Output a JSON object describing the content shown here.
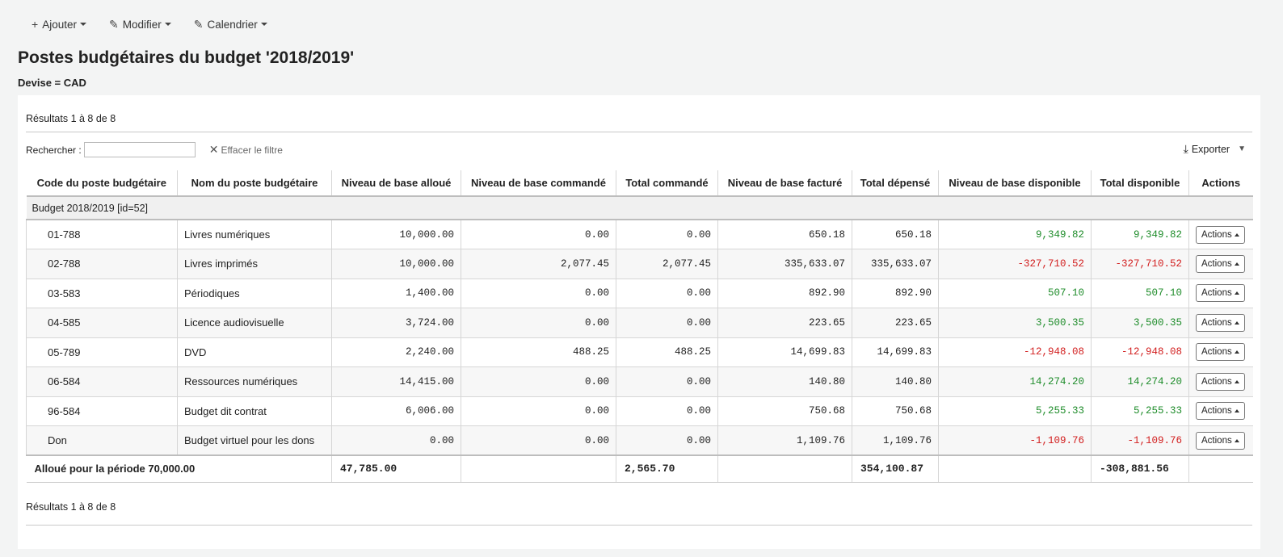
{
  "toolbar": {
    "add": "Ajouter",
    "edit": "Modifier",
    "calendar": "Calendrier"
  },
  "page": {
    "title": "Postes budgétaires du budget '2018/2019'",
    "currency_label": "Devise =",
    "currency_value": "CAD"
  },
  "results_info": "Résultats 1 à 8 de 8",
  "search": {
    "label": "Rechercher :",
    "value": "",
    "clear_label": "Effacer le filtre"
  },
  "export_label": "Exporter",
  "table": {
    "headers": [
      "Code du poste budgétaire",
      "Nom du poste budgétaire",
      "Niveau de base alloué",
      "Niveau de base commandé",
      "Total commandé",
      "Niveau de base facturé",
      "Total dépensé",
      "Niveau de base disponible",
      "Total disponible",
      "Actions"
    ],
    "group_label": "Budget 2018/2019 [id=52]",
    "rows": [
      {
        "code": "01-788",
        "name": "Livres numériques",
        "alloue": "10,000.00",
        "base_commande": "0.00",
        "total_commande": "0.00",
        "base_facture": "650.18",
        "total_depense": "650.18",
        "base_dispo": "9,349.82",
        "total_dispo": "9,349.82",
        "status": "pos"
      },
      {
        "code": "02-788",
        "name": "Livres imprimés",
        "alloue": "10,000.00",
        "base_commande": "2,077.45",
        "total_commande": "2,077.45",
        "base_facture": "335,633.07",
        "total_depense": "335,633.07",
        "base_dispo": "-327,710.52",
        "total_dispo": "-327,710.52",
        "status": "neg"
      },
      {
        "code": "03-583",
        "name": "Périodiques",
        "alloue": "1,400.00",
        "base_commande": "0.00",
        "total_commande": "0.00",
        "base_facture": "892.90",
        "total_depense": "892.90",
        "base_dispo": "507.10",
        "total_dispo": "507.10",
        "status": "pos"
      },
      {
        "code": "04-585",
        "name": "Licence audiovisuelle",
        "alloue": "3,724.00",
        "base_commande": "0.00",
        "total_commande": "0.00",
        "base_facture": "223.65",
        "total_depense": "223.65",
        "base_dispo": "3,500.35",
        "total_dispo": "3,500.35",
        "status": "pos"
      },
      {
        "code": "05-789",
        "name": "DVD",
        "alloue": "2,240.00",
        "base_commande": "488.25",
        "total_commande": "488.25",
        "base_facture": "14,699.83",
        "total_depense": "14,699.83",
        "base_dispo": "-12,948.08",
        "total_dispo": "-12,948.08",
        "status": "neg"
      },
      {
        "code": "06-584",
        "name": "Ressources numériques",
        "alloue": "14,415.00",
        "base_commande": "0.00",
        "total_commande": "0.00",
        "base_facture": "140.80",
        "total_depense": "140.80",
        "base_dispo": "14,274.20",
        "total_dispo": "14,274.20",
        "status": "pos"
      },
      {
        "code": "96-584",
        "name": "Budget dit contrat",
        "alloue": "6,006.00",
        "base_commande": "0.00",
        "total_commande": "0.00",
        "base_facture": "750.68",
        "total_depense": "750.68",
        "base_dispo": "5,255.33",
        "total_dispo": "5,255.33",
        "status": "pos"
      },
      {
        "code": "Don",
        "name": "Budget virtuel pour les dons",
        "alloue": "0.00",
        "base_commande": "0.00",
        "total_commande": "0.00",
        "base_facture": "1,109.76",
        "total_depense": "1,109.76",
        "base_dispo": "-1,109.76",
        "total_dispo": "-1,109.76",
        "status": "neg"
      }
    ],
    "action_label": "Actions",
    "footer": {
      "label": "Alloué pour la période 70,000.00",
      "alloue": "47,785.00",
      "total_commande": "2,565.70",
      "total_depense": "354,100.87",
      "total_dispo": "-308,881.56"
    }
  },
  "colors": {
    "positive": "#1e8c2a",
    "negative": "#d21e1e"
  }
}
